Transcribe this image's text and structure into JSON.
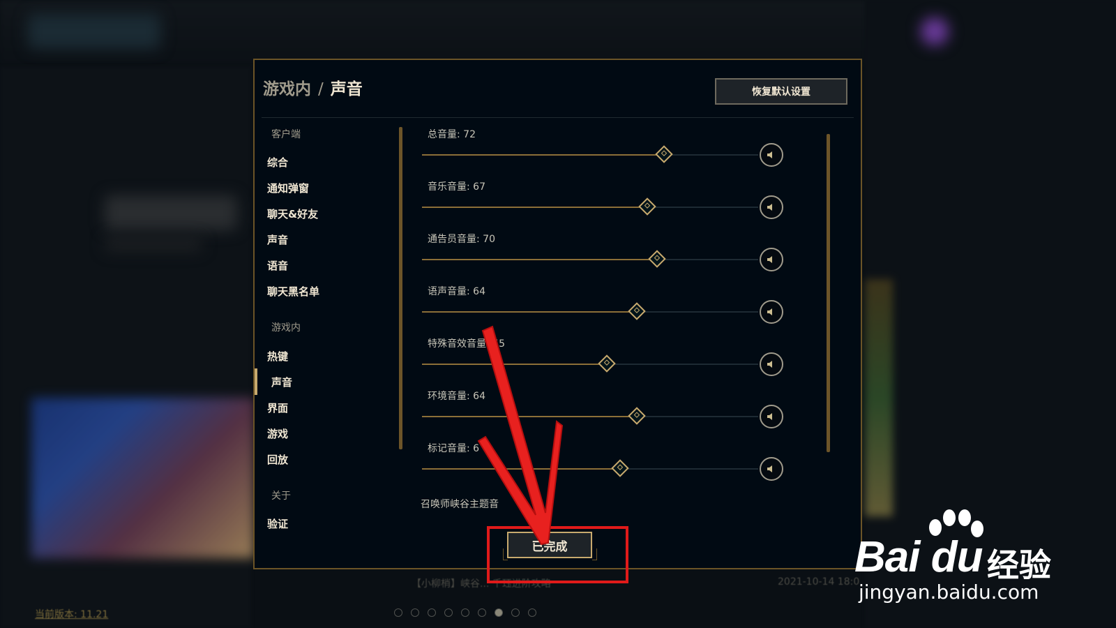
{
  "modal": {
    "breadcrumb_parent": "游戏内",
    "breadcrumb_sep": "/",
    "breadcrumb_current": "声音",
    "reset_label": "恢复默认设置",
    "done_label": "已完成"
  },
  "sidebar": {
    "groups": [
      {
        "title": "客户端",
        "items": [
          "综合",
          "通知弹窗",
          "聊天&好友",
          "声音",
          "语音",
          "聊天黑名单"
        ]
      },
      {
        "title": "游戏内",
        "items": [
          "热键",
          "声音",
          "界面",
          "游戏",
          "回放"
        ]
      },
      {
        "title": "关于",
        "items": [
          "验证"
        ]
      }
    ],
    "active_item": "声音"
  },
  "sliders": [
    {
      "label": "总音量: 72",
      "value": 72
    },
    {
      "label": "音乐音量: 67",
      "value": 67
    },
    {
      "label": "通告员音量: 70",
      "value": 70
    },
    {
      "label": "语声音量: 64",
      "value": 64
    },
    {
      "label": "特殊音效音量: 55",
      "value": 55
    },
    {
      "label": "环境音量: 64",
      "value": 64
    },
    {
      "label": "标记音量: 6",
      "value": 59
    }
  ],
  "bottom_label": "召唤师峡谷主题音",
  "background": {
    "version": "当前版本: 11.21",
    "news": "【小柳梢】峡谷... 千珏进阶攻略",
    "date": "2021-10-14 18:0"
  },
  "watermark": {
    "brand": "Bai du",
    "jy": "经验",
    "url": "jingyan.baidu.com"
  },
  "colors": {
    "gold": "#c8aa6e",
    "annotation_red": "#e01a1a"
  }
}
